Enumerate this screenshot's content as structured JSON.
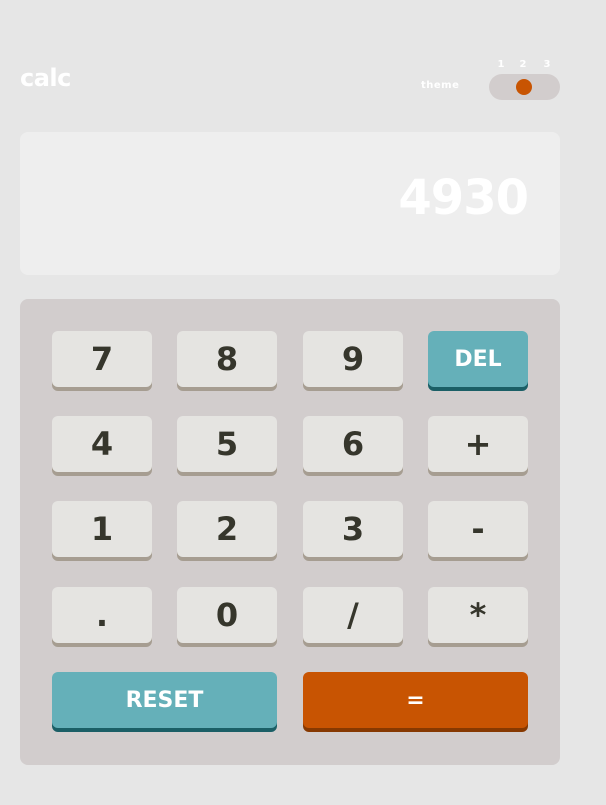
{
  "header": {
    "logo": "calc",
    "theme_label": "theme",
    "theme_options": [
      "1",
      "2",
      "3"
    ],
    "selected_theme": "2"
  },
  "display": {
    "value": "4930"
  },
  "keypad": {
    "row1": [
      "7",
      "8",
      "9",
      "DEL"
    ],
    "row2": [
      "4",
      "5",
      "6",
      "+"
    ],
    "row3": [
      "1",
      "2",
      "3",
      "-"
    ],
    "row4": [
      ".",
      "0",
      "/",
      "*"
    ],
    "reset_label": "RESET",
    "equals_label": "="
  },
  "colors": {
    "background": "#e6e6e6",
    "screen": "#eeeeee",
    "keypad": "#d2cdcd",
    "key": "#e5e4e1",
    "key_shadow": "#a69d91",
    "key_text": "#36362c",
    "accent_teal": "#65b0b9",
    "accent_teal_shadow": "#1b5f66",
    "accent_orange": "#c85402",
    "accent_orange_shadow": "#873901"
  }
}
